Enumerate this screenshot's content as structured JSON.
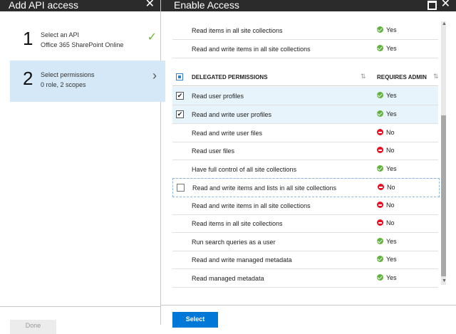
{
  "left_panel": {
    "title": "Add API access",
    "steps": [
      {
        "num": "1",
        "line1": "Select an API",
        "line2": "Office 365 SharePoint Online",
        "indicator": "checkmark"
      },
      {
        "num": "2",
        "line1": "Select permissions",
        "line2": "0 role, 2 scopes",
        "indicator": "chevron-right"
      }
    ],
    "done_label": "Done"
  },
  "right_panel": {
    "title": "Enable Access",
    "group_header": {
      "label": "DELEGATED PERMISSIONS",
      "requires_admin": "REQUIRES ADMIN"
    },
    "rows_above": [
      {
        "label": "Read items in all site collections",
        "admin": "Yes"
      },
      {
        "label": "Read and write items in all site collections",
        "admin": "Yes"
      }
    ],
    "rows": [
      {
        "label": "Read user profiles",
        "admin": "Yes",
        "checked": true
      },
      {
        "label": "Read and write user profiles",
        "admin": "Yes",
        "checked": true
      },
      {
        "label": "Read and write user files",
        "admin": "No",
        "checked": false
      },
      {
        "label": "Read user files",
        "admin": "No",
        "checked": false
      },
      {
        "label": "Have full control of all site collections",
        "admin": "Yes",
        "checked": false
      },
      {
        "label": "Read and write items and lists in all site collections",
        "admin": "No",
        "checked": false
      },
      {
        "label": "Read and write items in all site collections",
        "admin": "No",
        "checked": false
      },
      {
        "label": "Read items in all site collections",
        "admin": "No",
        "checked": false
      },
      {
        "label": "Run search queries as a user",
        "admin": "Yes",
        "checked": false
      },
      {
        "label": "Read and write managed metadata",
        "admin": "Yes",
        "checked": false
      },
      {
        "label": "Read managed metadata",
        "admin": "Yes",
        "checked": false
      }
    ],
    "select_label": "Select"
  },
  "colors": {
    "accent": "#0078d7",
    "yes": "#5fb33b",
    "no": "#e81123",
    "header": "#2b2b2b",
    "selected_step": "#d5e8f7"
  }
}
